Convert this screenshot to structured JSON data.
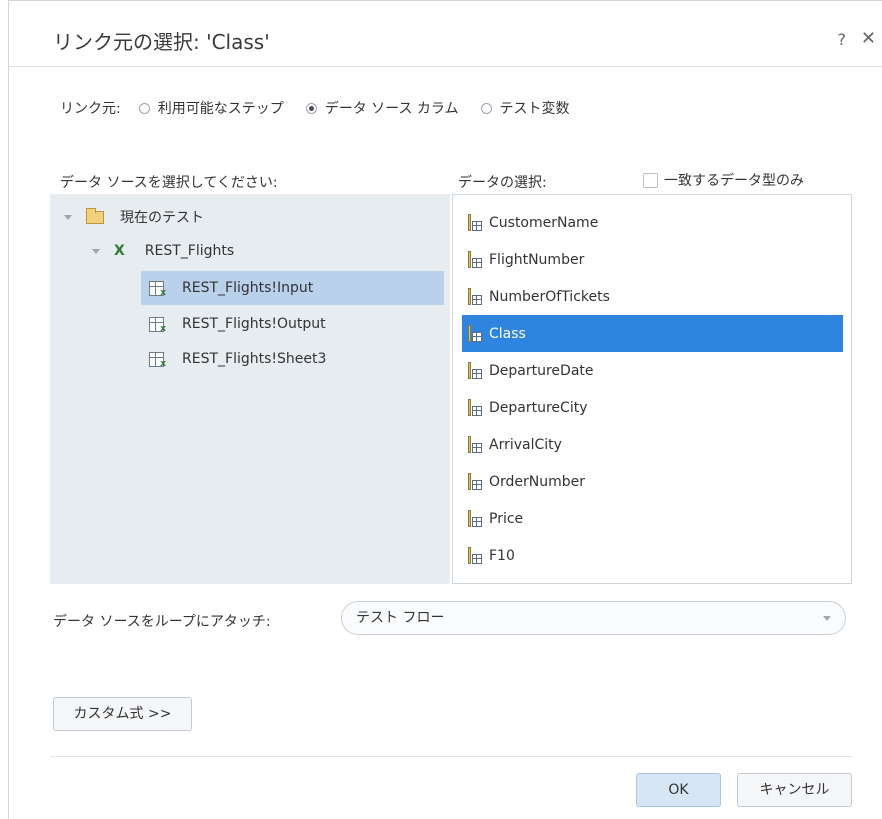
{
  "dialog": {
    "title": "リンク元の選択: 'Class'",
    "help": "?",
    "close": "✕"
  },
  "link_source": {
    "label": "リンク元:",
    "options": [
      {
        "label": "利用可能なステップ",
        "selected": false
      },
      {
        "label": "データ ソース カラム",
        "selected": true
      },
      {
        "label": "テスト変数",
        "selected": false
      }
    ]
  },
  "left": {
    "label": "データ ソースを選択してください:",
    "tree": {
      "root": "現在のテスト",
      "child": "REST_Flights",
      "sheets": [
        "REST_Flights!Input",
        "REST_Flights!Output",
        "REST_Flights!Sheet3"
      ],
      "selected_sheet": "REST_Flights!Input"
    }
  },
  "right": {
    "label": "データの選択:",
    "match_only_label": "一致するデータ型のみ",
    "match_only_checked": false,
    "columns": [
      "CustomerName",
      "FlightNumber",
      "NumberOfTickets",
      "Class",
      "DepartureDate",
      "DepartureCity",
      "ArrivalCity",
      "OrderNumber",
      "Price",
      "F10"
    ],
    "selected_column": "Class"
  },
  "loop": {
    "label": "データ ソースをループにアタッチ:",
    "value": "テスト フロー"
  },
  "buttons": {
    "custom": "カスタム式 >>",
    "ok": "OK",
    "cancel": "キャンセル"
  },
  "colors": {
    "selection": "#2f84e0",
    "tree_selection": "#b9d1ea",
    "panel_bg": "#e7ecf1"
  }
}
